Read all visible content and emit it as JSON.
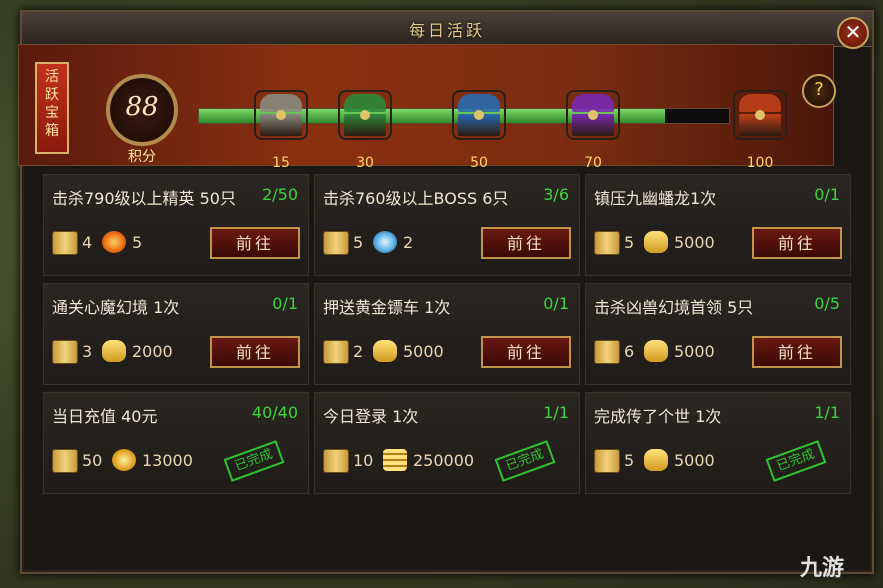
{
  "window": {
    "title": "每日活跃",
    "close_label": "✕"
  },
  "header": {
    "chest_label": [
      "活",
      "跃",
      "宝",
      "箱"
    ],
    "score": "88",
    "score_label": "积分",
    "help_label": "?",
    "progress": {
      "value": 88,
      "max": 100
    }
  },
  "milestones": [
    {
      "points": "15",
      "icon": "chest-gray-icon",
      "color": "#8a8a80"
    },
    {
      "points": "30",
      "icon": "chest-green-icon",
      "color": "#2e8a3a"
    },
    {
      "points": "50",
      "icon": "chest-blue-icon",
      "color": "#2a6ab0"
    },
    {
      "points": "70",
      "icon": "chest-purple-icon",
      "color": "#7a2ab0"
    },
    {
      "points": "100",
      "icon": "chest-red-gold-icon",
      "color": "#c0401a"
    }
  ],
  "tasks": [
    {
      "title": "击杀790级以上精英 50只",
      "count": "2/50",
      "rewards": [
        {
          "icon": "scroll-icon",
          "qty": "4"
        },
        {
          "icon": "fire-orb-icon",
          "qty": "5"
        }
      ],
      "action": "前往",
      "done": false
    },
    {
      "title": "击杀760级以上BOSS 6只",
      "count": "3/6",
      "rewards": [
        {
          "icon": "scroll-icon",
          "qty": "5"
        },
        {
          "icon": "crystal-icon",
          "qty": "2"
        }
      ],
      "action": "前往",
      "done": false
    },
    {
      "title": "镇压九幽蟠龙1次",
      "count": "0/1",
      "rewards": [
        {
          "icon": "scroll-icon",
          "qty": "5"
        },
        {
          "icon": "gold-ingot-icon",
          "qty": "5000"
        }
      ],
      "action": "前往",
      "done": false
    },
    {
      "title": "通关心魔幻境 1次",
      "count": "0/1",
      "rewards": [
        {
          "icon": "scroll-icon",
          "qty": "3"
        },
        {
          "icon": "gold-ingot-icon",
          "qty": "2000"
        }
      ],
      "action": "前往",
      "done": false
    },
    {
      "title": "押送黄金镖车 1次",
      "count": "0/1",
      "rewards": [
        {
          "icon": "scroll-icon",
          "qty": "2"
        },
        {
          "icon": "gold-ingot-icon",
          "qty": "5000"
        }
      ],
      "action": "前往",
      "done": false
    },
    {
      "title": "击杀凶兽幻境首领 5只",
      "count": "0/5",
      "rewards": [
        {
          "icon": "scroll-icon",
          "qty": "6"
        },
        {
          "icon": "gold-ingot-icon",
          "qty": "5000"
        }
      ],
      "action": "前往",
      "done": false
    },
    {
      "title": "当日充值 40元",
      "count": "40/40",
      "rewards": [
        {
          "icon": "scroll-icon",
          "qty": "50"
        },
        {
          "icon": "gold-coin-icon",
          "qty": "13000"
        }
      ],
      "action": "已完成",
      "done": true
    },
    {
      "title": "今日登录 1次",
      "count": "1/1",
      "rewards": [
        {
          "icon": "scroll-icon",
          "qty": "10"
        },
        {
          "icon": "coin-stack-icon",
          "qty": "250000"
        }
      ],
      "action": "已完成",
      "done": true
    },
    {
      "title": "完成传了个世 1次",
      "count": "1/1",
      "rewards": [
        {
          "icon": "scroll-icon",
          "qty": "5"
        },
        {
          "icon": "gold-ingot-icon",
          "qty": "5000"
        }
      ],
      "action": "已完成",
      "done": true
    }
  ],
  "watermark": "九游"
}
